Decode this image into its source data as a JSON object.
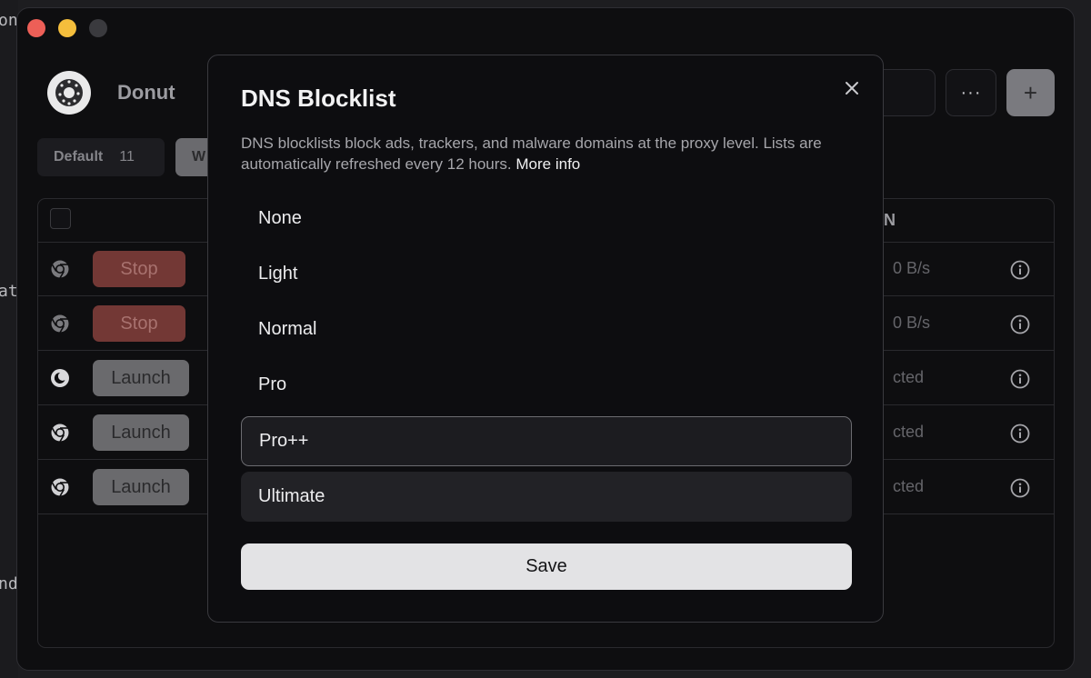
{
  "desktop": {
    "edge_texts": [
      "on",
      "at",
      "nd"
    ]
  },
  "app": {
    "name": "Donut"
  },
  "header": {
    "more_label": "···",
    "add_label": "+"
  },
  "groups": [
    {
      "label": "Default",
      "count": "11"
    },
    {
      "label": "W"
    }
  ],
  "table": {
    "column_partial": "N",
    "rows": [
      {
        "browser_icon": "chromium-icon",
        "action": "Stop",
        "status": "0 B/s"
      },
      {
        "browser_icon": "chromium-icon",
        "action": "Stop",
        "status": "0 B/s"
      },
      {
        "browser_icon": "firefox-icon",
        "action": "Launch",
        "status": "cted"
      },
      {
        "browser_icon": "chromium-icon",
        "action": "Launch",
        "status": "cted"
      },
      {
        "browser_icon": "chromium-icon",
        "action": "Launch",
        "status": "cted"
      }
    ]
  },
  "modal": {
    "title": "DNS Blocklist",
    "description": "DNS blocklists block ads, trackers, and malware domains at the proxy level. Lists are automatically refreshed every 12 hours.",
    "more_info": "More info",
    "options": [
      "None",
      "Light",
      "Normal",
      "Pro",
      "Pro++",
      "Ultimate"
    ],
    "selected": "Pro++",
    "hovered": "Ultimate",
    "save_label": "Save"
  },
  "colors": {
    "window_bg": "#0e0e10",
    "stop_button": "#733835",
    "launch_button": "#6a6a6d",
    "save_button": "#e3e3e5",
    "close_red": "#ed5f57",
    "minimize_yellow": "#f4be3c"
  }
}
